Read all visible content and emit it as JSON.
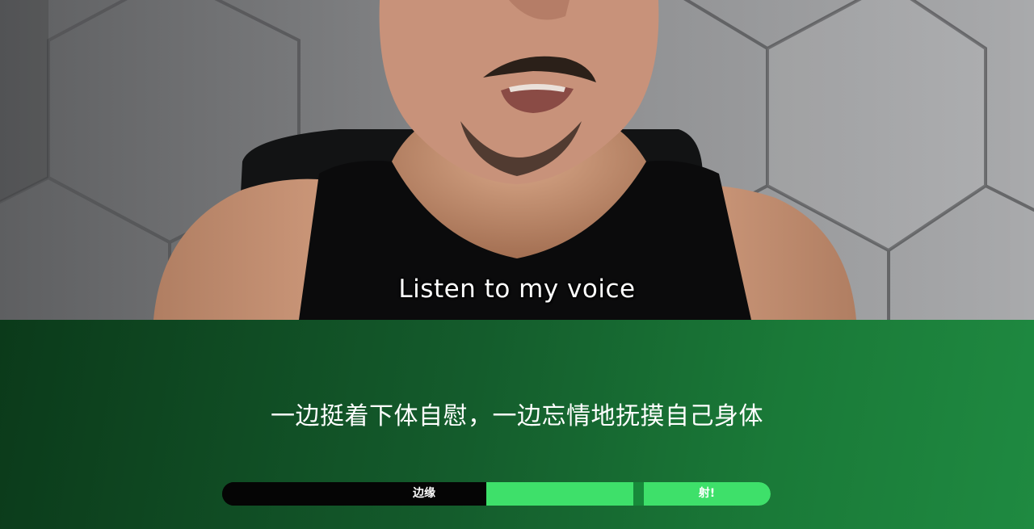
{
  "video": {
    "subtitle": "Listen to my voice"
  },
  "panel": {
    "text": "一边挺着下体自慰，一边忘情地抚摸自己身体"
  },
  "meter": {
    "edge_label": "边缘",
    "shoot_label": "射!",
    "colors": {
      "track": "#050505",
      "zone": "#3ee06a",
      "marker": "#178a3a"
    }
  }
}
